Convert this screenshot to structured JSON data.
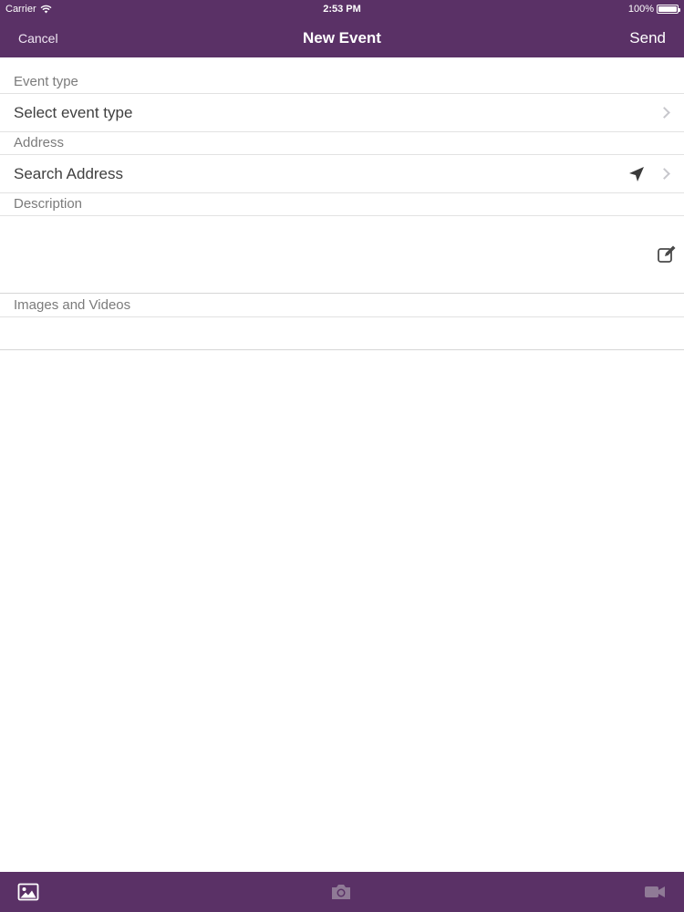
{
  "status_bar": {
    "carrier": "Carrier",
    "time": "2:53 PM",
    "battery": "100%"
  },
  "nav": {
    "cancel_label": "Cancel",
    "title": "New Event",
    "send_label": "Send"
  },
  "form": {
    "event_type": {
      "header": "Event type",
      "value": "Select event type"
    },
    "address": {
      "header": "Address",
      "value": "Search Address"
    },
    "description": {
      "header": "Description",
      "value": ""
    },
    "media": {
      "header": "Images and Videos"
    }
  },
  "toolbar": {
    "icons": [
      "image-icon",
      "camera-icon",
      "video-camera-icon"
    ]
  },
  "colors": {
    "brand": "#5a3166",
    "label": "#7b7b7b",
    "text": "#3f3f3f",
    "separator": "#e2e2e2"
  }
}
